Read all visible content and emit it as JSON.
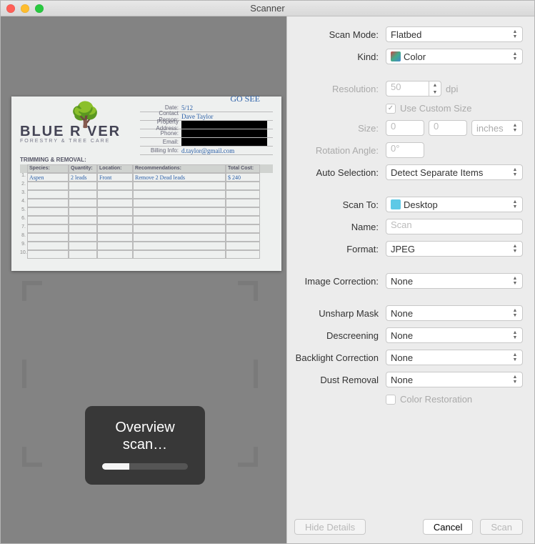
{
  "window": {
    "title": "Scanner"
  },
  "form": {
    "scan_mode": {
      "label": "Scan Mode:",
      "value": "Flatbed"
    },
    "kind": {
      "label": "Kind:",
      "value": "Color"
    },
    "resolution": {
      "label": "Resolution:",
      "value": "50",
      "unit": "dpi"
    },
    "use_custom_size": {
      "label": "Use Custom Size",
      "checked": true
    },
    "size": {
      "label": "Size:",
      "w": "0",
      "h": "0",
      "unit": "inches"
    },
    "rotation": {
      "label": "Rotation Angle:",
      "value": "0°"
    },
    "auto_selection": {
      "label": "Auto Selection:",
      "value": "Detect Separate Items"
    },
    "scan_to": {
      "label": "Scan To:",
      "value": "Desktop"
    },
    "name": {
      "label": "Name:",
      "placeholder": "Scan"
    },
    "format": {
      "label": "Format:",
      "value": "JPEG"
    },
    "image_correction": {
      "label": "Image Correction:",
      "value": "None"
    },
    "unsharp": {
      "label": "Unsharp Mask",
      "value": "None"
    },
    "descreen": {
      "label": "Descreening",
      "value": "None"
    },
    "backlight": {
      "label": "Backlight Correction",
      "value": "None"
    },
    "dust": {
      "label": "Dust Removal",
      "value": "None"
    },
    "color_restoration": {
      "label": "Color Restoration",
      "checked": false
    }
  },
  "buttons": {
    "hide_details": "Hide Details",
    "cancel": "Cancel",
    "scan": "Scan"
  },
  "toast": {
    "line1": "Overview",
    "line2": "scan…",
    "progress_pct": 32
  },
  "doc": {
    "gosee": "GO SEE",
    "logo": "BLUE R   VER",
    "logo_sub": "FORESTRY & TREE CARE",
    "fields": {
      "date": {
        "label": "Date:",
        "value": "5/12"
      },
      "contact": {
        "label": "Contact Person:",
        "value": "Dave Taylor"
      },
      "address": {
        "label": "Property Address:",
        "value": ""
      },
      "phone": {
        "label": "Phone:",
        "value": ""
      },
      "email": {
        "label": "Email:",
        "value": ""
      },
      "billing": {
        "label": "Billing Info:",
        "value": "d.taylor@gmail.com"
      }
    },
    "section": "TRIMMING & REMOVAL:",
    "headers": [
      "Species:",
      "Quantity:",
      "Location:",
      "Recommendations:",
      "Total Cost:"
    ],
    "rows": [
      [
        "Aspen",
        "2 leads",
        "Front",
        "Remove 2 Dead leads",
        "$ 240"
      ],
      [
        "",
        "",
        "",
        "",
        ""
      ],
      [
        "",
        "",
        "",
        "",
        ""
      ],
      [
        "",
        "",
        "",
        "",
        ""
      ],
      [
        "",
        "",
        "",
        "",
        ""
      ],
      [
        "",
        "",
        "",
        "",
        ""
      ],
      [
        "",
        "",
        "",
        "",
        ""
      ],
      [
        "",
        "",
        "",
        "",
        ""
      ],
      [
        "",
        "",
        "",
        "",
        ""
      ],
      [
        "",
        "",
        "",
        "",
        ""
      ]
    ]
  }
}
